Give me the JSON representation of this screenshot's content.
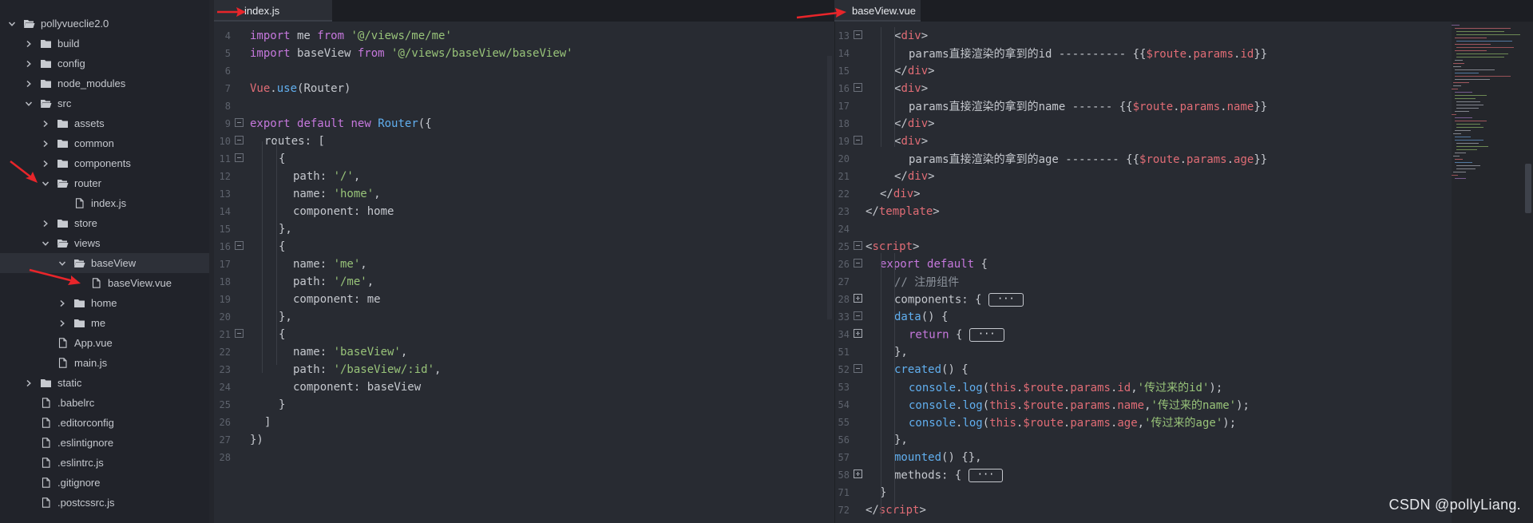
{
  "sidebar": {
    "items": [
      {
        "label": "pollyvueclie2.0",
        "kind": "folder-open",
        "depth": 0,
        "expanded": true
      },
      {
        "label": "build",
        "kind": "folder",
        "depth": 1,
        "expanded": false
      },
      {
        "label": "config",
        "kind": "folder",
        "depth": 1,
        "expanded": false
      },
      {
        "label": "node_modules",
        "kind": "folder",
        "depth": 1,
        "expanded": false
      },
      {
        "label": "src",
        "kind": "folder-open",
        "depth": 1,
        "expanded": true
      },
      {
        "label": "assets",
        "kind": "folder",
        "depth": 2,
        "expanded": false
      },
      {
        "label": "common",
        "kind": "folder",
        "depth": 2,
        "expanded": false
      },
      {
        "label": "components",
        "kind": "folder",
        "depth": 2,
        "expanded": false
      },
      {
        "label": "router",
        "kind": "folder-open",
        "depth": 2,
        "expanded": true
      },
      {
        "label": "index.js",
        "kind": "file",
        "depth": 3
      },
      {
        "label": "store",
        "kind": "folder",
        "depth": 2,
        "expanded": false
      },
      {
        "label": "views",
        "kind": "folder-open",
        "depth": 2,
        "expanded": true
      },
      {
        "label": "baseView",
        "kind": "folder-open",
        "depth": 3,
        "expanded": true,
        "selected": true
      },
      {
        "label": "baseView.vue",
        "kind": "file",
        "depth": 4
      },
      {
        "label": "home",
        "kind": "folder",
        "depth": 3,
        "expanded": false
      },
      {
        "label": "me",
        "kind": "folder",
        "depth": 3,
        "expanded": false
      },
      {
        "label": "App.vue",
        "kind": "file",
        "depth": 2
      },
      {
        "label": "main.js",
        "kind": "file",
        "depth": 2
      },
      {
        "label": "static",
        "kind": "folder",
        "depth": 1,
        "expanded": false
      },
      {
        "label": ".babelrc",
        "kind": "file",
        "depth": 1
      },
      {
        "label": ".editorconfig",
        "kind": "file",
        "depth": 1
      },
      {
        "label": ".eslintignore",
        "kind": "file",
        "depth": 1
      },
      {
        "label": ".eslintrc.js",
        "kind": "file",
        "depth": 1
      },
      {
        "label": ".gitignore",
        "kind": "file",
        "depth": 1
      },
      {
        "label": ".postcssrc.js",
        "kind": "file",
        "depth": 1
      }
    ]
  },
  "tabs": {
    "left": {
      "label": "index.js"
    },
    "right": {
      "label": "baseView.vue"
    }
  },
  "editor_left": {
    "lines": [
      {
        "n": "4",
        "fold": "",
        "indent": 0,
        "tokens": [
          [
            "kw",
            "import"
          ],
          [
            "punc",
            " me "
          ],
          [
            "kw",
            "from"
          ],
          [
            "punc",
            " "
          ],
          [
            "str",
            "'@/views/me/me'"
          ]
        ]
      },
      {
        "n": "5",
        "fold": "",
        "indent": 0,
        "tokens": [
          [
            "kw",
            "import"
          ],
          [
            "punc",
            " baseView "
          ],
          [
            "kw",
            "from"
          ],
          [
            "punc",
            " "
          ],
          [
            "str",
            "'@/views/baseView/baseView'"
          ]
        ]
      },
      {
        "n": "6",
        "fold": "",
        "indent": 0,
        "tokens": []
      },
      {
        "n": "7",
        "fold": "",
        "indent": 0,
        "tokens": [
          [
            "var",
            "Vue"
          ],
          [
            "punc",
            "."
          ],
          [
            "fn",
            "use"
          ],
          [
            "punc",
            "(Router)"
          ]
        ]
      },
      {
        "n": "8",
        "fold": "",
        "indent": 0,
        "tokens": []
      },
      {
        "n": "9",
        "fold": "minus",
        "indent": 0,
        "tokens": [
          [
            "kw",
            "export"
          ],
          [
            "punc",
            " "
          ],
          [
            "kw",
            "default"
          ],
          [
            "punc",
            " "
          ],
          [
            "kw",
            "new"
          ],
          [
            "punc",
            " "
          ],
          [
            "fn",
            "Router"
          ],
          [
            "punc",
            "({"
          ]
        ]
      },
      {
        "n": "10",
        "fold": "minus",
        "indent": 1,
        "tokens": [
          [
            "punc",
            "routes: ["
          ]
        ]
      },
      {
        "n": "11",
        "fold": "minus",
        "indent": 2,
        "tokens": [
          [
            "punc",
            "{"
          ]
        ]
      },
      {
        "n": "12",
        "fold": "",
        "indent": 3,
        "tokens": [
          [
            "punc",
            "path: "
          ],
          [
            "str",
            "'/'"
          ],
          [
            "punc",
            ","
          ]
        ]
      },
      {
        "n": "13",
        "fold": "",
        "indent": 3,
        "tokens": [
          [
            "punc",
            "name: "
          ],
          [
            "str",
            "'home'"
          ],
          [
            "punc",
            ","
          ]
        ]
      },
      {
        "n": "14",
        "fold": "",
        "indent": 3,
        "tokens": [
          [
            "punc",
            "component: home"
          ]
        ]
      },
      {
        "n": "15",
        "fold": "",
        "indent": 2,
        "tokens": [
          [
            "punc",
            "},"
          ]
        ]
      },
      {
        "n": "16",
        "fold": "minus",
        "indent": 2,
        "tokens": [
          [
            "punc",
            "{"
          ]
        ]
      },
      {
        "n": "17",
        "fold": "",
        "indent": 3,
        "tokens": [
          [
            "punc",
            "name: "
          ],
          [
            "str",
            "'me'"
          ],
          [
            "punc",
            ","
          ]
        ]
      },
      {
        "n": "18",
        "fold": "",
        "indent": 3,
        "tokens": [
          [
            "punc",
            "path: "
          ],
          [
            "str",
            "'/me'"
          ],
          [
            "punc",
            ","
          ]
        ]
      },
      {
        "n": "19",
        "fold": "",
        "indent": 3,
        "tokens": [
          [
            "punc",
            "component: me"
          ]
        ]
      },
      {
        "n": "20",
        "fold": "",
        "indent": 2,
        "tokens": [
          [
            "punc",
            "},"
          ]
        ]
      },
      {
        "n": "21",
        "fold": "minus",
        "indent": 2,
        "tokens": [
          [
            "punc",
            "{"
          ]
        ]
      },
      {
        "n": "22",
        "fold": "",
        "indent": 3,
        "tokens": [
          [
            "punc",
            "name: "
          ],
          [
            "str",
            "'baseView'"
          ],
          [
            "punc",
            ","
          ]
        ]
      },
      {
        "n": "23",
        "fold": "",
        "indent": 3,
        "tokens": [
          [
            "punc",
            "path: "
          ],
          [
            "str",
            "'/baseView/:id'"
          ],
          [
            "punc",
            ","
          ]
        ]
      },
      {
        "n": "24",
        "fold": "",
        "indent": 3,
        "tokens": [
          [
            "punc",
            "component: baseView"
          ]
        ]
      },
      {
        "n": "25",
        "fold": "",
        "indent": 2,
        "tokens": [
          [
            "punc",
            "}"
          ]
        ]
      },
      {
        "n": "26",
        "fold": "",
        "indent": 1,
        "tokens": [
          [
            "punc",
            "]"
          ]
        ]
      },
      {
        "n": "27",
        "fold": "",
        "indent": 0,
        "tokens": [
          [
            "punc",
            "})"
          ]
        ]
      },
      {
        "n": "28",
        "fold": "",
        "indent": 0,
        "tokens": []
      }
    ]
  },
  "editor_right": {
    "lines": [
      {
        "n": "13",
        "fold": "minus",
        "indent": 2,
        "tokens": [
          [
            "punc",
            "<"
          ],
          [
            "tag",
            "div"
          ],
          [
            "punc",
            ">"
          ]
        ]
      },
      {
        "n": "14",
        "fold": "",
        "indent": 3,
        "tokens": [
          [
            "punc",
            "params直接渲染的拿到的id ---------- {{"
          ],
          [
            "var",
            "$route"
          ],
          [
            "punc",
            "."
          ],
          [
            "var",
            "params"
          ],
          [
            "punc",
            "."
          ],
          [
            "var",
            "id"
          ],
          [
            "punc",
            "}}"
          ]
        ]
      },
      {
        "n": "15",
        "fold": "",
        "indent": 2,
        "tokens": [
          [
            "punc",
            "</"
          ],
          [
            "tag",
            "div"
          ],
          [
            "punc",
            ">"
          ]
        ]
      },
      {
        "n": "16",
        "fold": "minus",
        "indent": 2,
        "tokens": [
          [
            "punc",
            "<"
          ],
          [
            "tag",
            "div"
          ],
          [
            "punc",
            ">"
          ]
        ]
      },
      {
        "n": "17",
        "fold": "",
        "indent": 3,
        "tokens": [
          [
            "punc",
            "params直接渲染的拿到的name ------ {{"
          ],
          [
            "var",
            "$route"
          ],
          [
            "punc",
            "."
          ],
          [
            "var",
            "params"
          ],
          [
            "punc",
            "."
          ],
          [
            "var",
            "name"
          ],
          [
            "punc",
            "}}"
          ]
        ]
      },
      {
        "n": "18",
        "fold": "",
        "indent": 2,
        "tokens": [
          [
            "punc",
            "</"
          ],
          [
            "tag",
            "div"
          ],
          [
            "punc",
            ">"
          ]
        ]
      },
      {
        "n": "19",
        "fold": "minus",
        "indent": 2,
        "tokens": [
          [
            "punc",
            "<"
          ],
          [
            "tag",
            "div"
          ],
          [
            "punc",
            ">"
          ]
        ]
      },
      {
        "n": "20",
        "fold": "",
        "indent": 3,
        "tokens": [
          [
            "punc",
            "params直接渲染的拿到的age -------- {{"
          ],
          [
            "var",
            "$route"
          ],
          [
            "punc",
            "."
          ],
          [
            "var",
            "params"
          ],
          [
            "punc",
            "."
          ],
          [
            "var",
            "age"
          ],
          [
            "punc",
            "}}"
          ]
        ]
      },
      {
        "n": "21",
        "fold": "",
        "indent": 2,
        "tokens": [
          [
            "punc",
            "</"
          ],
          [
            "tag",
            "div"
          ],
          [
            "punc",
            ">"
          ]
        ]
      },
      {
        "n": "22",
        "fold": "",
        "indent": 1,
        "tokens": [
          [
            "punc",
            "</"
          ],
          [
            "tag",
            "div"
          ],
          [
            "punc",
            ">"
          ]
        ]
      },
      {
        "n": "23",
        "fold": "",
        "indent": 0,
        "tokens": [
          [
            "punc",
            "</"
          ],
          [
            "tag",
            "template"
          ],
          [
            "punc",
            ">"
          ]
        ]
      },
      {
        "n": "24",
        "fold": "",
        "indent": 0,
        "tokens": []
      },
      {
        "n": "25",
        "fold": "minus",
        "indent": 0,
        "tokens": [
          [
            "punc",
            "<"
          ],
          [
            "tag",
            "script"
          ],
          [
            "punc",
            ">"
          ]
        ]
      },
      {
        "n": "26",
        "fold": "minus",
        "indent": 1,
        "tokens": [
          [
            "kw",
            "export"
          ],
          [
            "punc",
            " "
          ],
          [
            "kw",
            "default"
          ],
          [
            "punc",
            " {"
          ]
        ]
      },
      {
        "n": "27",
        "fold": "",
        "indent": 2,
        "tokens": [
          [
            "cm",
            "// 注册组件"
          ]
        ]
      },
      {
        "n": "28",
        "fold": "plus",
        "indent": 2,
        "tokens": [
          [
            "punc",
            "components: { "
          ],
          [
            "collapsed",
            "···"
          ]
        ]
      },
      {
        "n": "33",
        "fold": "minus",
        "indent": 2,
        "tokens": [
          [
            "fn",
            "data"
          ],
          [
            "punc",
            "() {"
          ]
        ]
      },
      {
        "n": "34",
        "fold": "plus",
        "indent": 3,
        "tokens": [
          [
            "kw",
            "return"
          ],
          [
            "punc",
            " { "
          ],
          [
            "collapsed",
            "···"
          ]
        ]
      },
      {
        "n": "51",
        "fold": "",
        "indent": 2,
        "tokens": [
          [
            "punc",
            "},"
          ]
        ]
      },
      {
        "n": "52",
        "fold": "minus",
        "indent": 2,
        "tokens": [
          [
            "fn",
            "created"
          ],
          [
            "punc",
            "() {"
          ]
        ]
      },
      {
        "n": "53",
        "fold": "",
        "indent": 3,
        "tokens": [
          [
            "fn",
            "console"
          ],
          [
            "punc",
            "."
          ],
          [
            "fn",
            "log"
          ],
          [
            "punc",
            "("
          ],
          [
            "var",
            "this"
          ],
          [
            "punc",
            "."
          ],
          [
            "var",
            "$route"
          ],
          [
            "punc",
            "."
          ],
          [
            "var",
            "params"
          ],
          [
            "punc",
            "."
          ],
          [
            "var",
            "id"
          ],
          [
            "punc",
            ","
          ],
          [
            "str",
            "'传过来的id'"
          ],
          [
            "punc",
            ");"
          ]
        ]
      },
      {
        "n": "54",
        "fold": "",
        "indent": 3,
        "tokens": [
          [
            "fn",
            "console"
          ],
          [
            "punc",
            "."
          ],
          [
            "fn",
            "log"
          ],
          [
            "punc",
            "("
          ],
          [
            "var",
            "this"
          ],
          [
            "punc",
            "."
          ],
          [
            "var",
            "$route"
          ],
          [
            "punc",
            "."
          ],
          [
            "var",
            "params"
          ],
          [
            "punc",
            "."
          ],
          [
            "var",
            "name"
          ],
          [
            "punc",
            ","
          ],
          [
            "str",
            "'传过来的name'"
          ],
          [
            "punc",
            ");"
          ]
        ]
      },
      {
        "n": "55",
        "fold": "",
        "indent": 3,
        "tokens": [
          [
            "fn",
            "console"
          ],
          [
            "punc",
            "."
          ],
          [
            "fn",
            "log"
          ],
          [
            "punc",
            "("
          ],
          [
            "var",
            "this"
          ],
          [
            "punc",
            "."
          ],
          [
            "var",
            "$route"
          ],
          [
            "punc",
            "."
          ],
          [
            "var",
            "params"
          ],
          [
            "punc",
            "."
          ],
          [
            "var",
            "age"
          ],
          [
            "punc",
            ","
          ],
          [
            "str",
            "'传过来的age'"
          ],
          [
            "punc",
            ");"
          ]
        ]
      },
      {
        "n": "56",
        "fold": "",
        "indent": 2,
        "tokens": [
          [
            "punc",
            "},"
          ]
        ]
      },
      {
        "n": "57",
        "fold": "",
        "indent": 2,
        "tokens": [
          [
            "fn",
            "mounted"
          ],
          [
            "punc",
            "() {},"
          ]
        ]
      },
      {
        "n": "58",
        "fold": "plus",
        "indent": 2,
        "tokens": [
          [
            "punc",
            "methods: { "
          ],
          [
            "collapsed",
            "···"
          ]
        ]
      },
      {
        "n": "71",
        "fold": "",
        "indent": 1,
        "tokens": [
          [
            "punc",
            "}"
          ]
        ]
      },
      {
        "n": "72",
        "fold": "",
        "indent": 0,
        "tokens": [
          [
            "punc",
            "</"
          ],
          [
            "tag",
            "script"
          ],
          [
            "punc",
            ">"
          ]
        ]
      }
    ]
  },
  "watermark": {
    "text": "CSDN @pollyLiang."
  },
  "colors": {
    "arrow": "#e8252a",
    "keyword": "#c678dd",
    "string": "#98c379",
    "function": "#61afef",
    "tag": "#e06c75"
  }
}
